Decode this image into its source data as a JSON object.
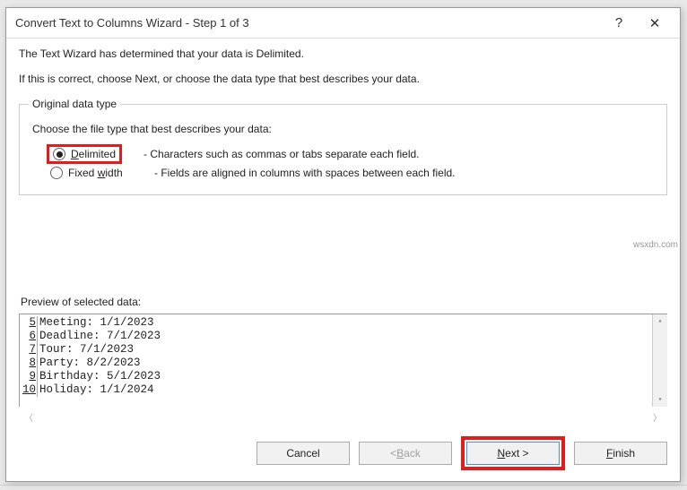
{
  "dialog": {
    "title": "Convert Text to Columns Wizard - Step 1 of 3",
    "help_icon": "?",
    "close_icon": "✕"
  },
  "intro": {
    "line1": "The Text Wizard has determined that your data is Delimited.",
    "line2": "If this is correct, choose Next, or choose the data type that best describes your data."
  },
  "group": {
    "legend": "Original data type",
    "choose": "Choose the file type that best describes your data:",
    "options": [
      {
        "accel": "D",
        "rest": "elimited",
        "desc": "- Characters such as commas or tabs separate each field.",
        "checked": true
      },
      {
        "pre": "Fixed ",
        "accel": "w",
        "rest": "idth",
        "desc": "- Fields are aligned in columns with spaces between each field.",
        "checked": false
      }
    ]
  },
  "preview": {
    "label": "Preview of selected data:",
    "rows": [
      {
        "n": "5",
        "text": "Meeting: 1/1/2023"
      },
      {
        "n": "6",
        "text": "Deadline: 7/1/2023"
      },
      {
        "n": "7",
        "text": "Tour: 7/1/2023"
      },
      {
        "n": "8",
        "text": "Party: 8/2/2023"
      },
      {
        "n": "9",
        "text": "Birthday: 5/1/2023"
      },
      {
        "n": "10",
        "text": "Holiday: 1/1/2024"
      }
    ]
  },
  "buttons": {
    "cancel": "Cancel",
    "back_prefix": "< ",
    "back_accel": "B",
    "back_rest": "ack",
    "next_accel": "N",
    "next_rest": "ext >",
    "finish_accel": "F",
    "finish_rest": "inish"
  },
  "watermark": "wsxdn.com"
}
